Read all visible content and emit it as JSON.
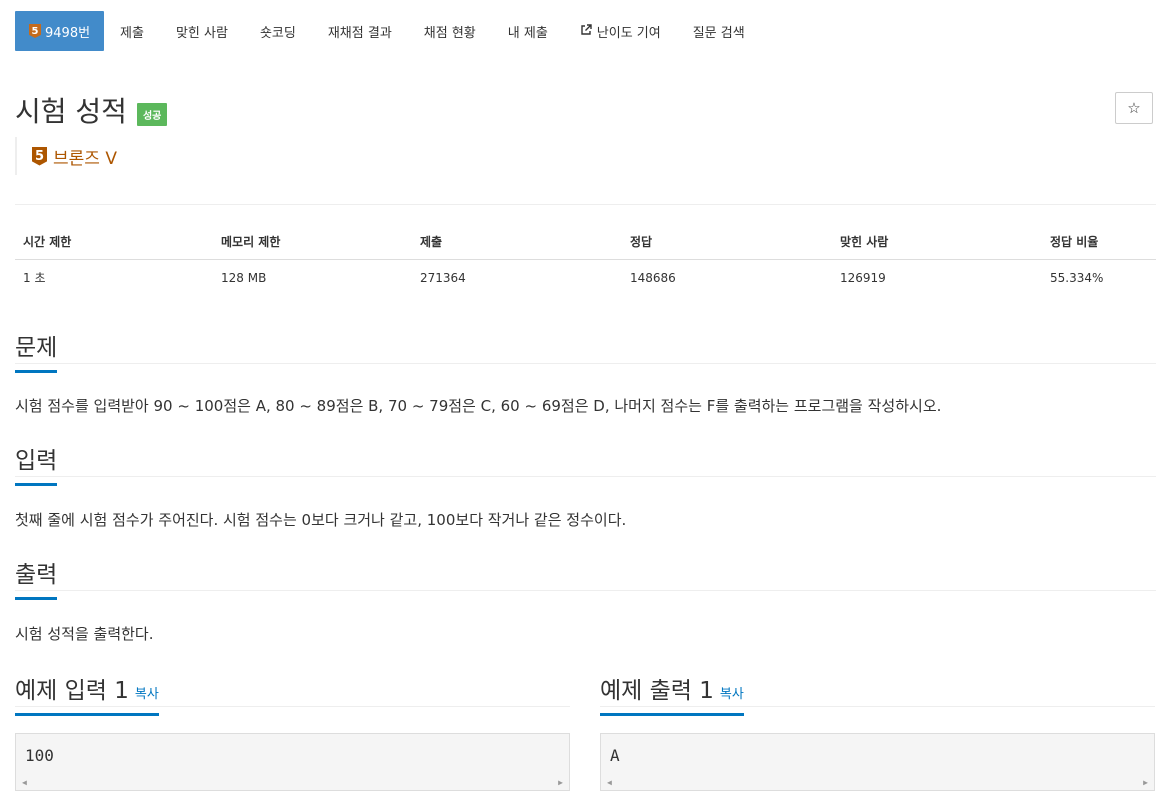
{
  "nav": {
    "problem_tab": "9498번",
    "problem_tier_level": "5",
    "tabs": [
      "제출",
      "맞힌 사람",
      "숏코딩",
      "재채점 결과",
      "채점 현황",
      "내 제출",
      "난이도 기여",
      "질문 검색"
    ]
  },
  "problem": {
    "title": "시험 성적",
    "result_badge": "성공",
    "tier_level": "5",
    "tier_name": "브론즈 V",
    "star_icon": "☆"
  },
  "info_table": {
    "headers": [
      "시간 제한",
      "메모리 제한",
      "제출",
      "정답",
      "맞힌 사람",
      "정답 비율"
    ],
    "values": [
      "1 초",
      "128 MB",
      "271364",
      "148686",
      "126919",
      "55.334%"
    ]
  },
  "sections": {
    "problem_heading": "문제",
    "problem_text": "시험 점수를 입력받아 90 ~ 100점은 A, 80 ~ 89점은 B, 70 ~ 79점은 C, 60 ~ 69점은 D, 나머지 점수는 F를 출력하는 프로그램을 작성하시오.",
    "input_heading": "입력",
    "input_text": "첫째 줄에 시험 점수가 주어진다. 시험 점수는 0보다 크거나 같고, 100보다 작거나 같은 정수이다.",
    "output_heading": "출력",
    "output_text": "시험 성적을 출력한다."
  },
  "samples": {
    "input_heading": "예제 입력 1",
    "output_heading": "예제 출력 1",
    "copy_label": "복사",
    "input_value": "100",
    "output_value": "A"
  },
  "colors": {
    "accent": "#428bca",
    "bronze": "#ad5600",
    "success": "#5cb85c",
    "heading_underline": "#0076c0"
  }
}
